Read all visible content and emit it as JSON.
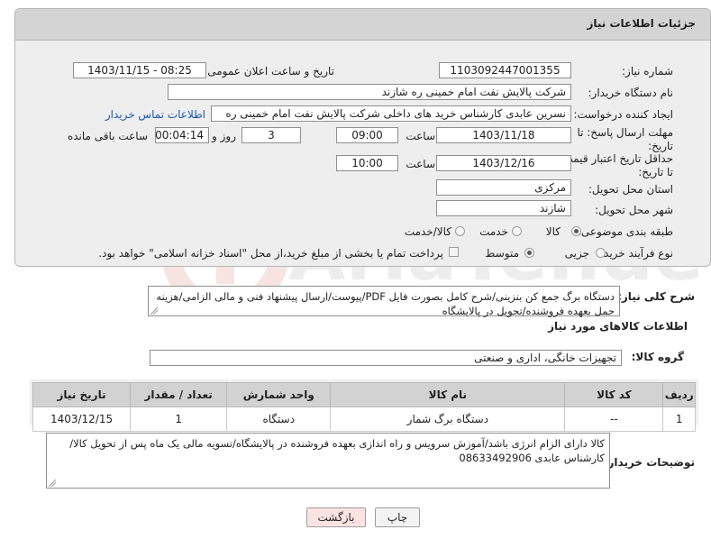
{
  "panel": {
    "title": "جزئیات اطلاعات نیاز"
  },
  "labels": {
    "need_number": "شماره نیاز:",
    "announce_datetime": "تاریخ و ساعت اعلان عمومی:",
    "buyer_org": "نام دستگاه خریدار:",
    "requester": "ایجاد کننده درخواست:",
    "reply_deadline": "مهلت ارسال پاسخ: تا تاریخ:",
    "hour": "ساعت",
    "day_and": "روز و",
    "remaining": "ساعت باقی مانده",
    "price_validity": "حداقل تاریخ اعتبار قیمت: تا تاریخ:",
    "delivery_province": "استان محل تحویل:",
    "delivery_city": "شهر محل تحویل:",
    "subject_category": "طبقه بندی موضوعی:",
    "purchase_process": "نوع فرآیند خرید :",
    "general_desc": "شرح کلی نیاز:",
    "goods_info": "اطلاعات کالاهای مورد نیاز",
    "goods_group": "گروه کالا:",
    "buyer_notes": "توضیحات خریدار:"
  },
  "values": {
    "need_number": "1103092447001355",
    "announce_datetime": "1403/11/15 - 08:25",
    "buyer_org": "شرکت پالایش نفت امام خمینی  ره  شازند",
    "requester": "نسرین عابدی کارشناس خرید های داخلی  شرکت پالایش نفت امام خمینی  ره",
    "contact_link": "اطلاعات تماس خریدار",
    "reply_date": "1403/11/18",
    "reply_time": "09:00",
    "reply_days": "3",
    "reply_remaining": "00:04:14",
    "validity_date": "1403/12/16",
    "validity_time": "10:00",
    "province": "مرکزی",
    "city": "شازند",
    "general_desc": "دستگاه برگ جمع کن بنزینی/شرح کامل بصورت فایل PDF/پیوست/ارسال پیشنهاد فنی و مالی الزامی/هزینه حمل بعهده فروشنده/تحویل در پالایشگاه",
    "goods_group": "تجهیزات خانگی، اداری و صنعتی",
    "buyer_notes": "کالا دارای الزام انرژی باشد/آموزش سرویس و راه اندازی بعهده فروشنده در پالایشگاه/تسویه مالی یک ماه پس از تحویل کالا/کارشناس عابدی 08633492906"
  },
  "category_options": {
    "goods": "کالا",
    "service": "خدمت",
    "goods_service": "کالا/خدمت",
    "selected": "goods"
  },
  "process_options": {
    "minor": "جزیی",
    "medium": "متوسط",
    "treasury_note": "پرداخت تمام یا بخشی از مبلغ خرید،از محل \"اسناد خزانه اسلامی\" خواهد بود.",
    "selected": "medium"
  },
  "table": {
    "headers": [
      "ردیف",
      "کد کالا",
      "نام کالا",
      "واحد شمارش",
      "تعداد / مقدار",
      "تاریخ نیاز"
    ],
    "rows": [
      [
        "1",
        "--",
        "دستگاه برگ شمار",
        "دستگاه",
        "1",
        "1403/12/15"
      ]
    ]
  },
  "buttons": {
    "print": "چاپ",
    "back": "بازگشت"
  },
  "colors": {
    "accent_link": "#1a57b0",
    "back_button_bg": "#fbe3e3",
    "header_bg": "#d4d4d4"
  }
}
